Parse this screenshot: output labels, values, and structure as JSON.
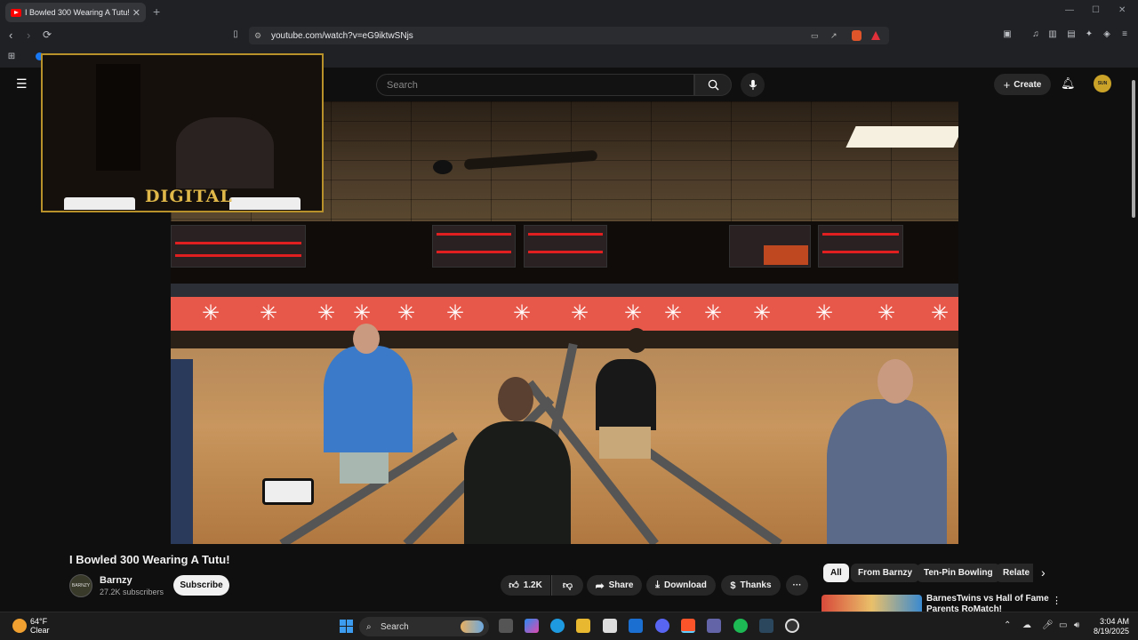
{
  "browser": {
    "tab_title": "I Bowled 300 Wearing A Tutu!",
    "url": "youtube.com/watch?v=eG9iktwSNjs",
    "new_tab": "+",
    "min": "—",
    "max": "☐",
    "close": "✕"
  },
  "youtube": {
    "search_placeholder": "Search",
    "create_label": "Create",
    "avatar_text": "SUN"
  },
  "webcam": {
    "logo_text": "DIGITAL"
  },
  "video_info": {
    "title": "I Bowled 300 Wearing A Tutu!",
    "channel_name": "Barnzy",
    "subscribers": "27.2K subscribers",
    "channel_avatar_text": "BARNZY",
    "subscribe_label": "Subscribe",
    "like_count": "1.2K",
    "share_label": "Share",
    "download_label": "Download",
    "thanks_label": "Thanks",
    "more_label": "···"
  },
  "chips": [
    "All",
    "From Barnzy",
    "Ten-Pin Bowling",
    "Relate"
  ],
  "related": {
    "title": "BarnesTwins vs Hall of Fame Parents RoMatch!"
  },
  "taskbar": {
    "temp": "64°F",
    "condition": "Clear",
    "search_label": "Search",
    "time": "3:04 AM",
    "date": "8/19/2025"
  },
  "colors": {
    "youtube_red": "#ff0000",
    "subscribe_bg": "#f1f1f1",
    "chip_active": "#f1f1f1"
  }
}
